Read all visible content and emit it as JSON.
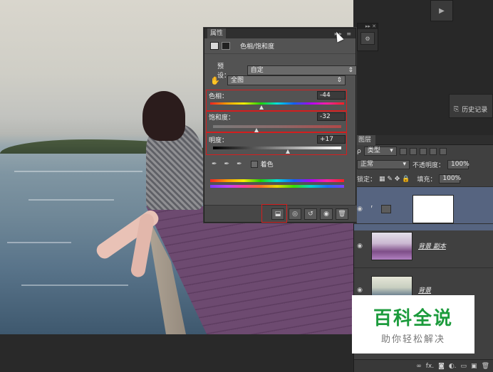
{
  "properties_panel": {
    "tab_title": "属性",
    "header_title": "色相/饱和度",
    "preset_label": "预设：",
    "preset_value": "自定",
    "channel_value": "全图",
    "hue_label": "色相：",
    "hue_value": "-44",
    "hue_fraction": 0.38,
    "saturation_label": "饱和度：",
    "saturation_value": "-32",
    "saturation_fraction": 0.34,
    "lightness_label": "明度：",
    "lightness_value": "+17",
    "lightness_fraction": 0.585,
    "colorize_label": "着色"
  },
  "history_panel": {
    "label": "历史记录"
  },
  "layers_panel": {
    "tab_title": "图层",
    "filter_value": "类型",
    "blend_mode": "正常",
    "opacity_label": "不透明度：",
    "opacity_value": "100%",
    "lock_label": "锁定：",
    "fill_label": "填充：",
    "fill_value": "100%",
    "layers": [
      {
        "name": ""
      },
      {
        "name": "背景 副本"
      },
      {
        "name": "背景"
      }
    ]
  },
  "watermark": {
    "title": "百科全说",
    "subtitle": "助你轻松解决"
  },
  "colors": {
    "highlight": "#d41e1e",
    "watermark_green": "#1c9b3c"
  }
}
